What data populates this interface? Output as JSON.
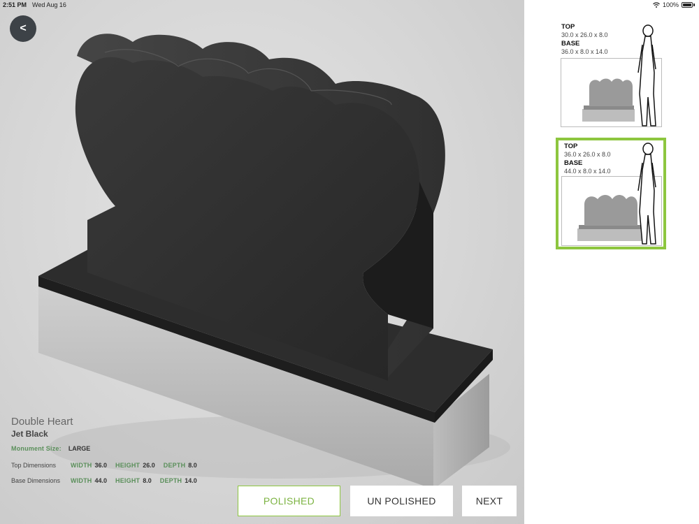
{
  "status": {
    "time": "2:51 PM",
    "date": "Wed Aug 16",
    "battery": "100%"
  },
  "viewer": {
    "back_icon": "chevron-left-icon",
    "product_name": "Double Heart",
    "product_color": "Jet Black",
    "monument_size_label": "Monument Size:",
    "monument_size_value": "LARGE",
    "top_dimensions": {
      "label": "Top Dimensions",
      "width_label": "WIDTH",
      "width": "36.0",
      "height_label": "HEIGHT",
      "height": "26.0",
      "depth_label": "DEPTH",
      "depth": "8.0"
    },
    "base_dimensions": {
      "label": "Base Dimensions",
      "width_label": "WIDTH",
      "width": "44.0",
      "height_label": "HEIGHT",
      "height": "8.0",
      "depth_label": "DEPTH",
      "depth": "14.0"
    }
  },
  "buttons": {
    "polished": "POLISHED",
    "unpolished": "UN POLISHED",
    "next": "NEXT"
  },
  "options": [
    {
      "top_label": "TOP",
      "top_value": "30.0 x 26.0 x 8.0",
      "base_label": "BASE",
      "base_value": "36.0 x 8.0 x 14.0",
      "selected": false
    },
    {
      "top_label": "TOP",
      "top_value": "36.0 x 26.0 x 8.0",
      "base_label": "BASE",
      "base_value": "44.0 x 8.0 x 14.0",
      "selected": true
    }
  ],
  "colors": {
    "accent": "#8dc63f",
    "label_green": "#5a8f5a",
    "granite": "#2a2a2a"
  }
}
